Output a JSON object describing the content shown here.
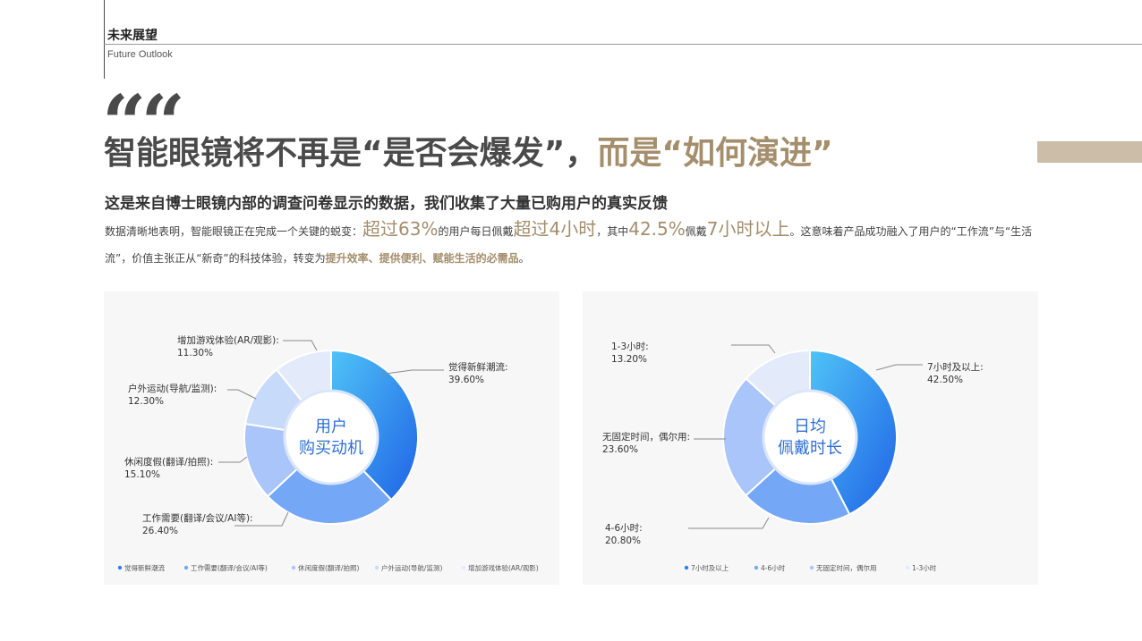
{
  "header": {
    "section_title": "未来展望",
    "section_subtitle": "Future Outlook"
  },
  "hero": {
    "quote_mark": "““",
    "headline_dark": "智能眼镜将不再是“是否会爆发”，",
    "headline_gold": "而是“如何演进”",
    "subtitle": "这是来自博士眼镜内部的调查问卷显示的数据，我们收集了大量已购用户的真实反馈"
  },
  "paragraph": {
    "p1": "数据清晰地表明，智能眼镜正在完成一个关键的蜕变：",
    "h1": "超过63%",
    "p2": "的用户每日佩戴",
    "h2": "超过4小时",
    "p3": "，其中",
    "h3": "42.5%",
    "p4": "佩戴",
    "h4": "7小时以上",
    "p5": "。这意味着产品成功融入了用户的“工作流”与“生活流”，价值主张正从“新奇”的科技体验，转变为",
    "h5": "提升效率、提供便利、赋能生活的必需品",
    "p6": "。"
  },
  "colors": {
    "gold": "#a48e6c",
    "dark": "#4a4a4a",
    "accent_bar": "#cbbda7",
    "center_text": "#2f6fd6"
  },
  "chart_data": [
    {
      "type": "pie",
      "center_label": [
        "用户",
        "购买动机"
      ],
      "categories": [
        "觉得新鲜潮流",
        "工作需要(翻译/会议/AI等)",
        "休闲度假(翻译/拍照)",
        "户外运动(导航/监测)",
        "增加游戏体验(AR/观影)"
      ],
      "callout_labels": [
        "觉得新鲜潮流:",
        "工作需要(翻译/会议/AI等):",
        "休闲度假(翻译/拍照):",
        "户外运动(导航/监测):",
        "增加游戏体验(AR/观影):"
      ],
      "values": [
        39.6,
        26.4,
        15.1,
        12.3,
        11.3
      ],
      "value_labels": [
        "39.60%",
        "26.40%",
        "15.10%",
        "12.30%",
        "11.30%"
      ],
      "colors": [
        "#2f80ed",
        "#74a7f6",
        "#a9c5f9",
        "#c8daf9",
        "#e3ebfb"
      ],
      "legend_position": "bottom"
    },
    {
      "type": "pie",
      "center_label": [
        "日均",
        "佩戴时长"
      ],
      "categories": [
        "7小时及以上",
        "4-6小时",
        "无固定时间，偶尔用",
        "1-3小时"
      ],
      "callout_labels": [
        "7小时及以上:",
        "4-6小时:",
        "无固定时间，偶尔用:",
        "1-3小时:"
      ],
      "values": [
        42.5,
        20.8,
        23.6,
        13.2
      ],
      "value_labels": [
        "42.50%",
        "20.80%",
        "23.60%",
        "13.20%"
      ],
      "colors": [
        "#2f80ed",
        "#74a7f6",
        "#a9c5f9",
        "#e3ebfb"
      ],
      "legend_position": "bottom"
    }
  ]
}
